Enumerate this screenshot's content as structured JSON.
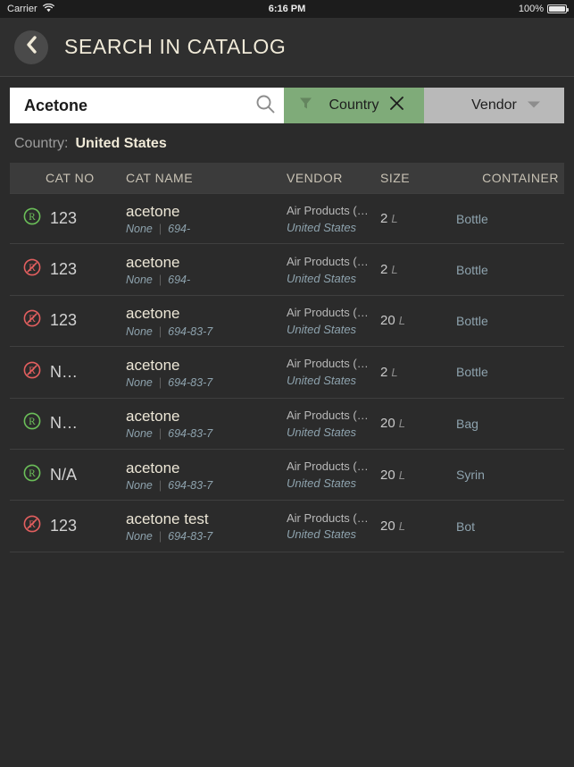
{
  "status_bar": {
    "carrier": "Carrier",
    "wifi_icon": "wifi-icon",
    "time": "6:16 PM",
    "battery_percent": "100%",
    "battery_icon": "battery-full-icon"
  },
  "header": {
    "back_icon": "chevron-left-icon",
    "title": "SEARCH IN CATALOG"
  },
  "search": {
    "value": "Acetone",
    "placeholder": "Search",
    "search_icon": "search-icon",
    "filters": [
      {
        "label": "Country",
        "state": "active",
        "color": "#7fab79",
        "left_icon": "funnel-icon",
        "right_icon": "close-icon"
      },
      {
        "label": "Vendor",
        "state": "inactive",
        "color": "#b9b9b9",
        "right_icon": "chevron-down-icon"
      }
    ]
  },
  "active_filter": {
    "key": "Country:",
    "value": "United States"
  },
  "table": {
    "columns": [
      "CAT NO",
      "CAT NAME",
      "VENDOR",
      "SIZE",
      "CONTAINER"
    ],
    "rows": [
      {
        "status_icon": "registered-ok-icon",
        "status_color": "#6bbf59",
        "cat_no": "123",
        "cat_name": "acetone",
        "cat_sub_left": "None",
        "cat_sub_sep": "|",
        "cat_sub_right": "694-",
        "vendor": "Air Products (…",
        "vendor_country": "United States",
        "size": "2",
        "size_unit": "L",
        "container": "Bottle"
      },
      {
        "status_icon": "registered-blocked-icon",
        "status_color": "#e35f5f",
        "cat_no": "123",
        "cat_name": "acetone",
        "cat_sub_left": "None",
        "cat_sub_sep": "|",
        "cat_sub_right": "694-",
        "vendor": "Air Products (…",
        "vendor_country": "United States",
        "size": "2",
        "size_unit": "L",
        "container": "Bottle"
      },
      {
        "status_icon": "registered-blocked-icon",
        "status_color": "#e35f5f",
        "cat_no": "123",
        "cat_name": "acetone",
        "cat_sub_left": "None",
        "cat_sub_sep": "|",
        "cat_sub_right": "694-83-7",
        "vendor": "Air Products (…",
        "vendor_country": "United States",
        "size": "20",
        "size_unit": "L",
        "container": "Bottle"
      },
      {
        "status_icon": "registered-blocked-icon",
        "status_color": "#e35f5f",
        "cat_no": "N…",
        "cat_name": "acetone",
        "cat_sub_left": "None",
        "cat_sub_sep": "|",
        "cat_sub_right": "694-83-7",
        "vendor": "Air Products (…",
        "vendor_country": "United States",
        "size": "2",
        "size_unit": "L",
        "container": "Bottle"
      },
      {
        "status_icon": "registered-ok-icon",
        "status_color": "#6bbf59",
        "cat_no": "N…",
        "cat_name": "acetone",
        "cat_sub_left": "None",
        "cat_sub_sep": "|",
        "cat_sub_right": "694-83-7",
        "vendor": "Air Products (…",
        "vendor_country": "United States",
        "size": "20",
        "size_unit": "L",
        "container": "Bag"
      },
      {
        "status_icon": "registered-ok-icon",
        "status_color": "#6bbf59",
        "cat_no": "N/A",
        "cat_name": "acetone",
        "cat_sub_left": "None",
        "cat_sub_sep": "|",
        "cat_sub_right": "694-83-7",
        "vendor": "Air Products (…",
        "vendor_country": "United States",
        "size": "20",
        "size_unit": "L",
        "container": "Syrin"
      },
      {
        "status_icon": "registered-blocked-icon",
        "status_color": "#e35f5f",
        "cat_no": "123",
        "cat_name": "acetone test",
        "cat_sub_left": "None",
        "cat_sub_sep": "|",
        "cat_sub_right": "694-83-7",
        "vendor": "Air Products (…",
        "vendor_country": "United States",
        "size": "20",
        "size_unit": "L",
        "container": "Bot"
      }
    ]
  }
}
